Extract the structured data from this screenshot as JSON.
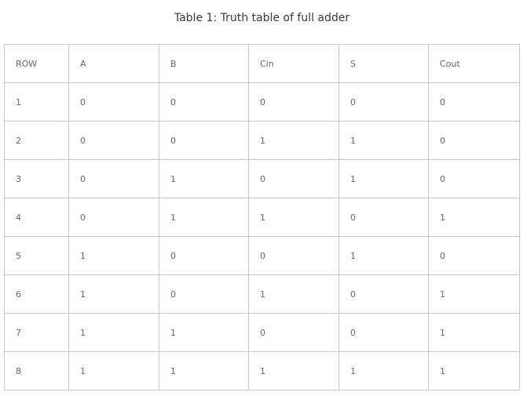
{
  "caption": "Table 1: Truth table of full adder",
  "table": {
    "headers": [
      "ROW",
      "A",
      "B",
      "Cin",
      "S",
      "Cout"
    ],
    "rows": [
      [
        "1",
        "0",
        "0",
        "0",
        "0",
        "0"
      ],
      [
        "2",
        "0",
        "0",
        "1",
        "1",
        "0"
      ],
      [
        "3",
        "0",
        "1",
        "0",
        "1",
        "0"
      ],
      [
        "4",
        "0",
        "1",
        "1",
        "0",
        "1"
      ],
      [
        "5",
        "1",
        "0",
        "0",
        "1",
        "0"
      ],
      [
        "6",
        "1",
        "0",
        "1",
        "0",
        "1"
      ],
      [
        "7",
        "1",
        "1",
        "0",
        "0",
        "1"
      ],
      [
        "8",
        "1",
        "1",
        "1",
        "1",
        "1"
      ]
    ]
  },
  "colors": {
    "border": "#c9c9c9",
    "text": "#666666",
    "caption": "#3a3a3a"
  }
}
